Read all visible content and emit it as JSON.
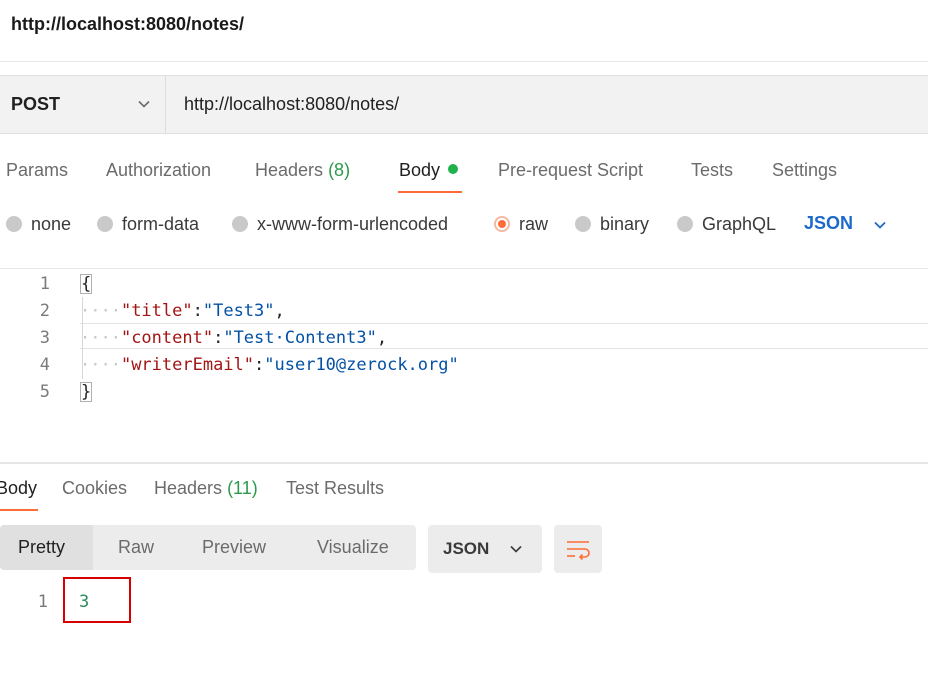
{
  "title": "http://localhost:8080/notes/",
  "request": {
    "method": "POST",
    "url": "http://localhost:8080/notes/"
  },
  "request_tabs": {
    "params": "Params",
    "authorization": "Authorization",
    "headers": "Headers",
    "headers_count": "(8)",
    "body": "Body",
    "prerequest": "Pre-request Script",
    "tests": "Tests",
    "settings": "Settings"
  },
  "body_types": {
    "none": "none",
    "form_data": "form-data",
    "urlencoded": "x-www-form-urlencoded",
    "raw": "raw",
    "binary": "binary",
    "graphql": "GraphQL",
    "selected": "raw",
    "language": "JSON"
  },
  "editor": {
    "line_numbers": [
      "1",
      "2",
      "3",
      "4",
      "5"
    ],
    "open_brace": "{",
    "close_brace": "}",
    "lines": [
      {
        "key": "\"title\"",
        "value": "\"Test3\"",
        "suffix": ","
      },
      {
        "key": "\"content\"",
        "value": "\"Test·Content3\"",
        "suffix": ","
      },
      {
        "key": "\"writerEmail\"",
        "value": "\"user10@zerock.org\"",
        "suffix": ""
      }
    ],
    "indent_dots": "····",
    "colon": ":"
  },
  "response_tabs": {
    "body": "Body",
    "cookies": "Cookies",
    "headers": "Headers",
    "headers_count": "(11)",
    "test_results": "Test Results"
  },
  "response_view": {
    "pretty": "Pretty",
    "raw": "Raw",
    "preview": "Preview",
    "visualize": "Visualize",
    "format": "JSON"
  },
  "response_body": {
    "line_number": "1",
    "value": "3"
  },
  "colors": {
    "accent": "#ff6c37",
    "json_blue": "#1d69c9",
    "status_green": "#20b14c",
    "highlight_red": "#d60000"
  }
}
